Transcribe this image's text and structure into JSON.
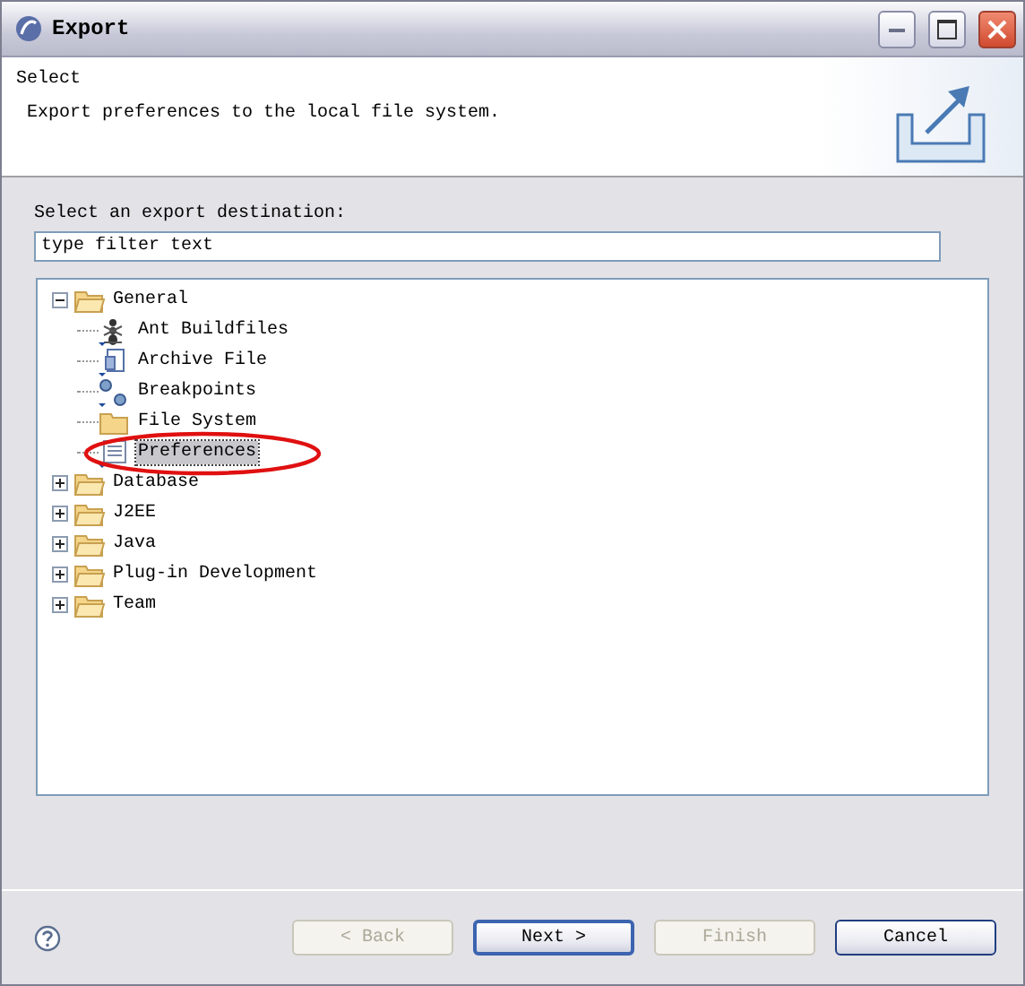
{
  "window": {
    "title": "Export"
  },
  "header": {
    "title": "Select",
    "description": "Export preferences to the local file system."
  },
  "destination_label": "Select an export destination:",
  "filter": {
    "value": "type filter text"
  },
  "tree": [
    {
      "label": "General",
      "kind": "folder",
      "expanded": true,
      "selected": false,
      "children": [
        {
          "label": "Ant Buildfiles",
          "kind": "ant",
          "selected": false,
          "circled": false
        },
        {
          "label": "Archive File",
          "kind": "archive",
          "selected": false,
          "circled": false
        },
        {
          "label": "Breakpoints",
          "kind": "breakpoint",
          "selected": false,
          "circled": false
        },
        {
          "label": "File System",
          "kind": "folder",
          "selected": false,
          "circled": false
        },
        {
          "label": "Preferences",
          "kind": "page",
          "selected": true,
          "circled": true
        }
      ]
    },
    {
      "label": "Database",
      "kind": "folder",
      "expanded": false,
      "selected": false
    },
    {
      "label": "J2EE",
      "kind": "folder",
      "expanded": false,
      "selected": false
    },
    {
      "label": "Java",
      "kind": "folder",
      "expanded": false,
      "selected": false
    },
    {
      "label": "Plug-in Development",
      "kind": "folder",
      "expanded": false,
      "selected": false
    },
    {
      "label": "Team",
      "kind": "folder",
      "expanded": false,
      "selected": false
    }
  ],
  "buttons": [
    {
      "label": "< Back",
      "disabled": true,
      "default": false
    },
    {
      "label": "Next >",
      "disabled": false,
      "default": true
    },
    {
      "label": "Finish",
      "disabled": true,
      "default": false
    },
    {
      "label": "Cancel",
      "disabled": false,
      "default": false
    }
  ]
}
